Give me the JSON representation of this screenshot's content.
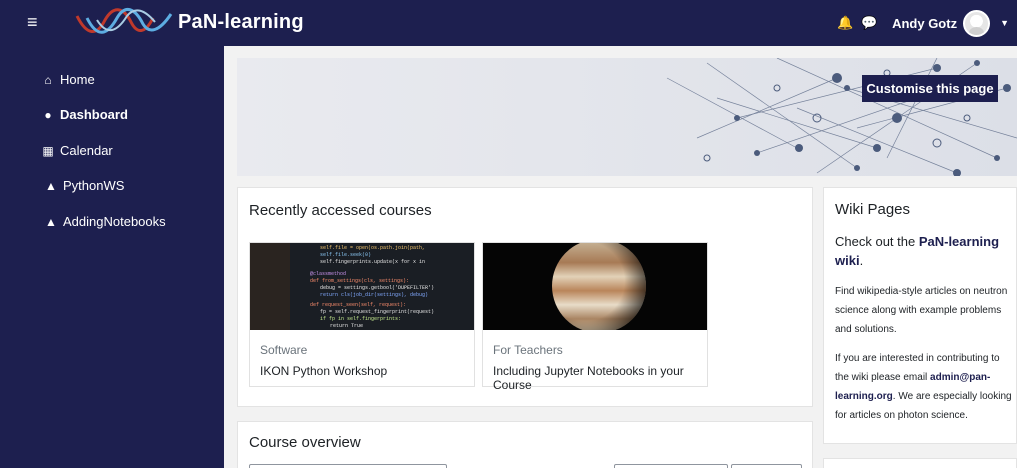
{
  "navbar": {
    "brand": "PaN-learning",
    "username": "Andy Gotz",
    "colors": {
      "bar": "#1d1f4f",
      "text": "#ffffff"
    }
  },
  "sidebar": {
    "items": [
      {
        "label": "Home",
        "icon": "home-icon"
      },
      {
        "label": "Dashboard",
        "icon": "dashboard-icon"
      },
      {
        "label": "Calendar",
        "icon": "calendar-icon"
      },
      {
        "label": "PythonWS",
        "icon": "graduation-cap-icon"
      },
      {
        "label": "AddingNotebooks",
        "icon": "graduation-cap-icon"
      }
    ]
  },
  "banner": {
    "customise_label": "Customise this page"
  },
  "recent": {
    "title": "Recently accessed courses",
    "courses": [
      {
        "category": "Software",
        "name": "IKON Python Workshop",
        "image": "code-screen-image"
      },
      {
        "category": "For Teachers",
        "name": "Including Jupyter Notebooks in your Course",
        "image": "jupiter-planet-image"
      }
    ]
  },
  "overview": {
    "title": "Course overview"
  },
  "wiki": {
    "title": "Wiki Pages",
    "lead_prefix": "Check out the ",
    "lead_link": "PaN-learning wiki",
    "lead_suffix": ".",
    "p1": "Find wikipedia-style articles on neutron science along with example problems and solutions.",
    "p2_prefix": "If you are interested in contributing to the wiki please email ",
    "p2_email": "admin@pan-learning.org",
    "p2_suffix": ". We are especially looking for articles on photon science."
  }
}
